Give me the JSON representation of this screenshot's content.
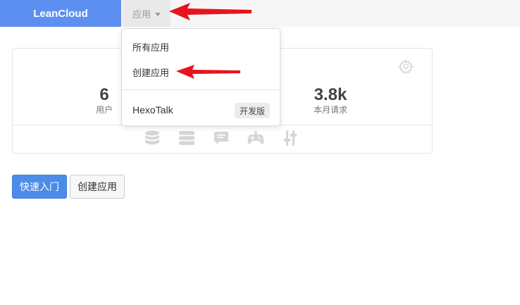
{
  "header": {
    "brand": "LeanCloud",
    "apps_menu_label": "应用"
  },
  "stats": {
    "users_value": "6",
    "users_label": "用户",
    "requests_value": "3.8k",
    "requests_label": "本月请求"
  },
  "dropdown": {
    "all_apps": "所有应用",
    "create_app": "创建应用",
    "app_name": "HexoTalk",
    "app_badge": "开发版"
  },
  "buttons": {
    "quickstart": "快速入门",
    "create_app": "创建应用"
  },
  "icons": [
    "database-icon",
    "server-icon",
    "message-icon",
    "gamepad-icon",
    "settings-sliders-icon",
    "gear-icon"
  ],
  "colors": {
    "brand": "#5d8ff0",
    "primary_button": "#4c8ce8",
    "arrow": "#e8131d"
  }
}
